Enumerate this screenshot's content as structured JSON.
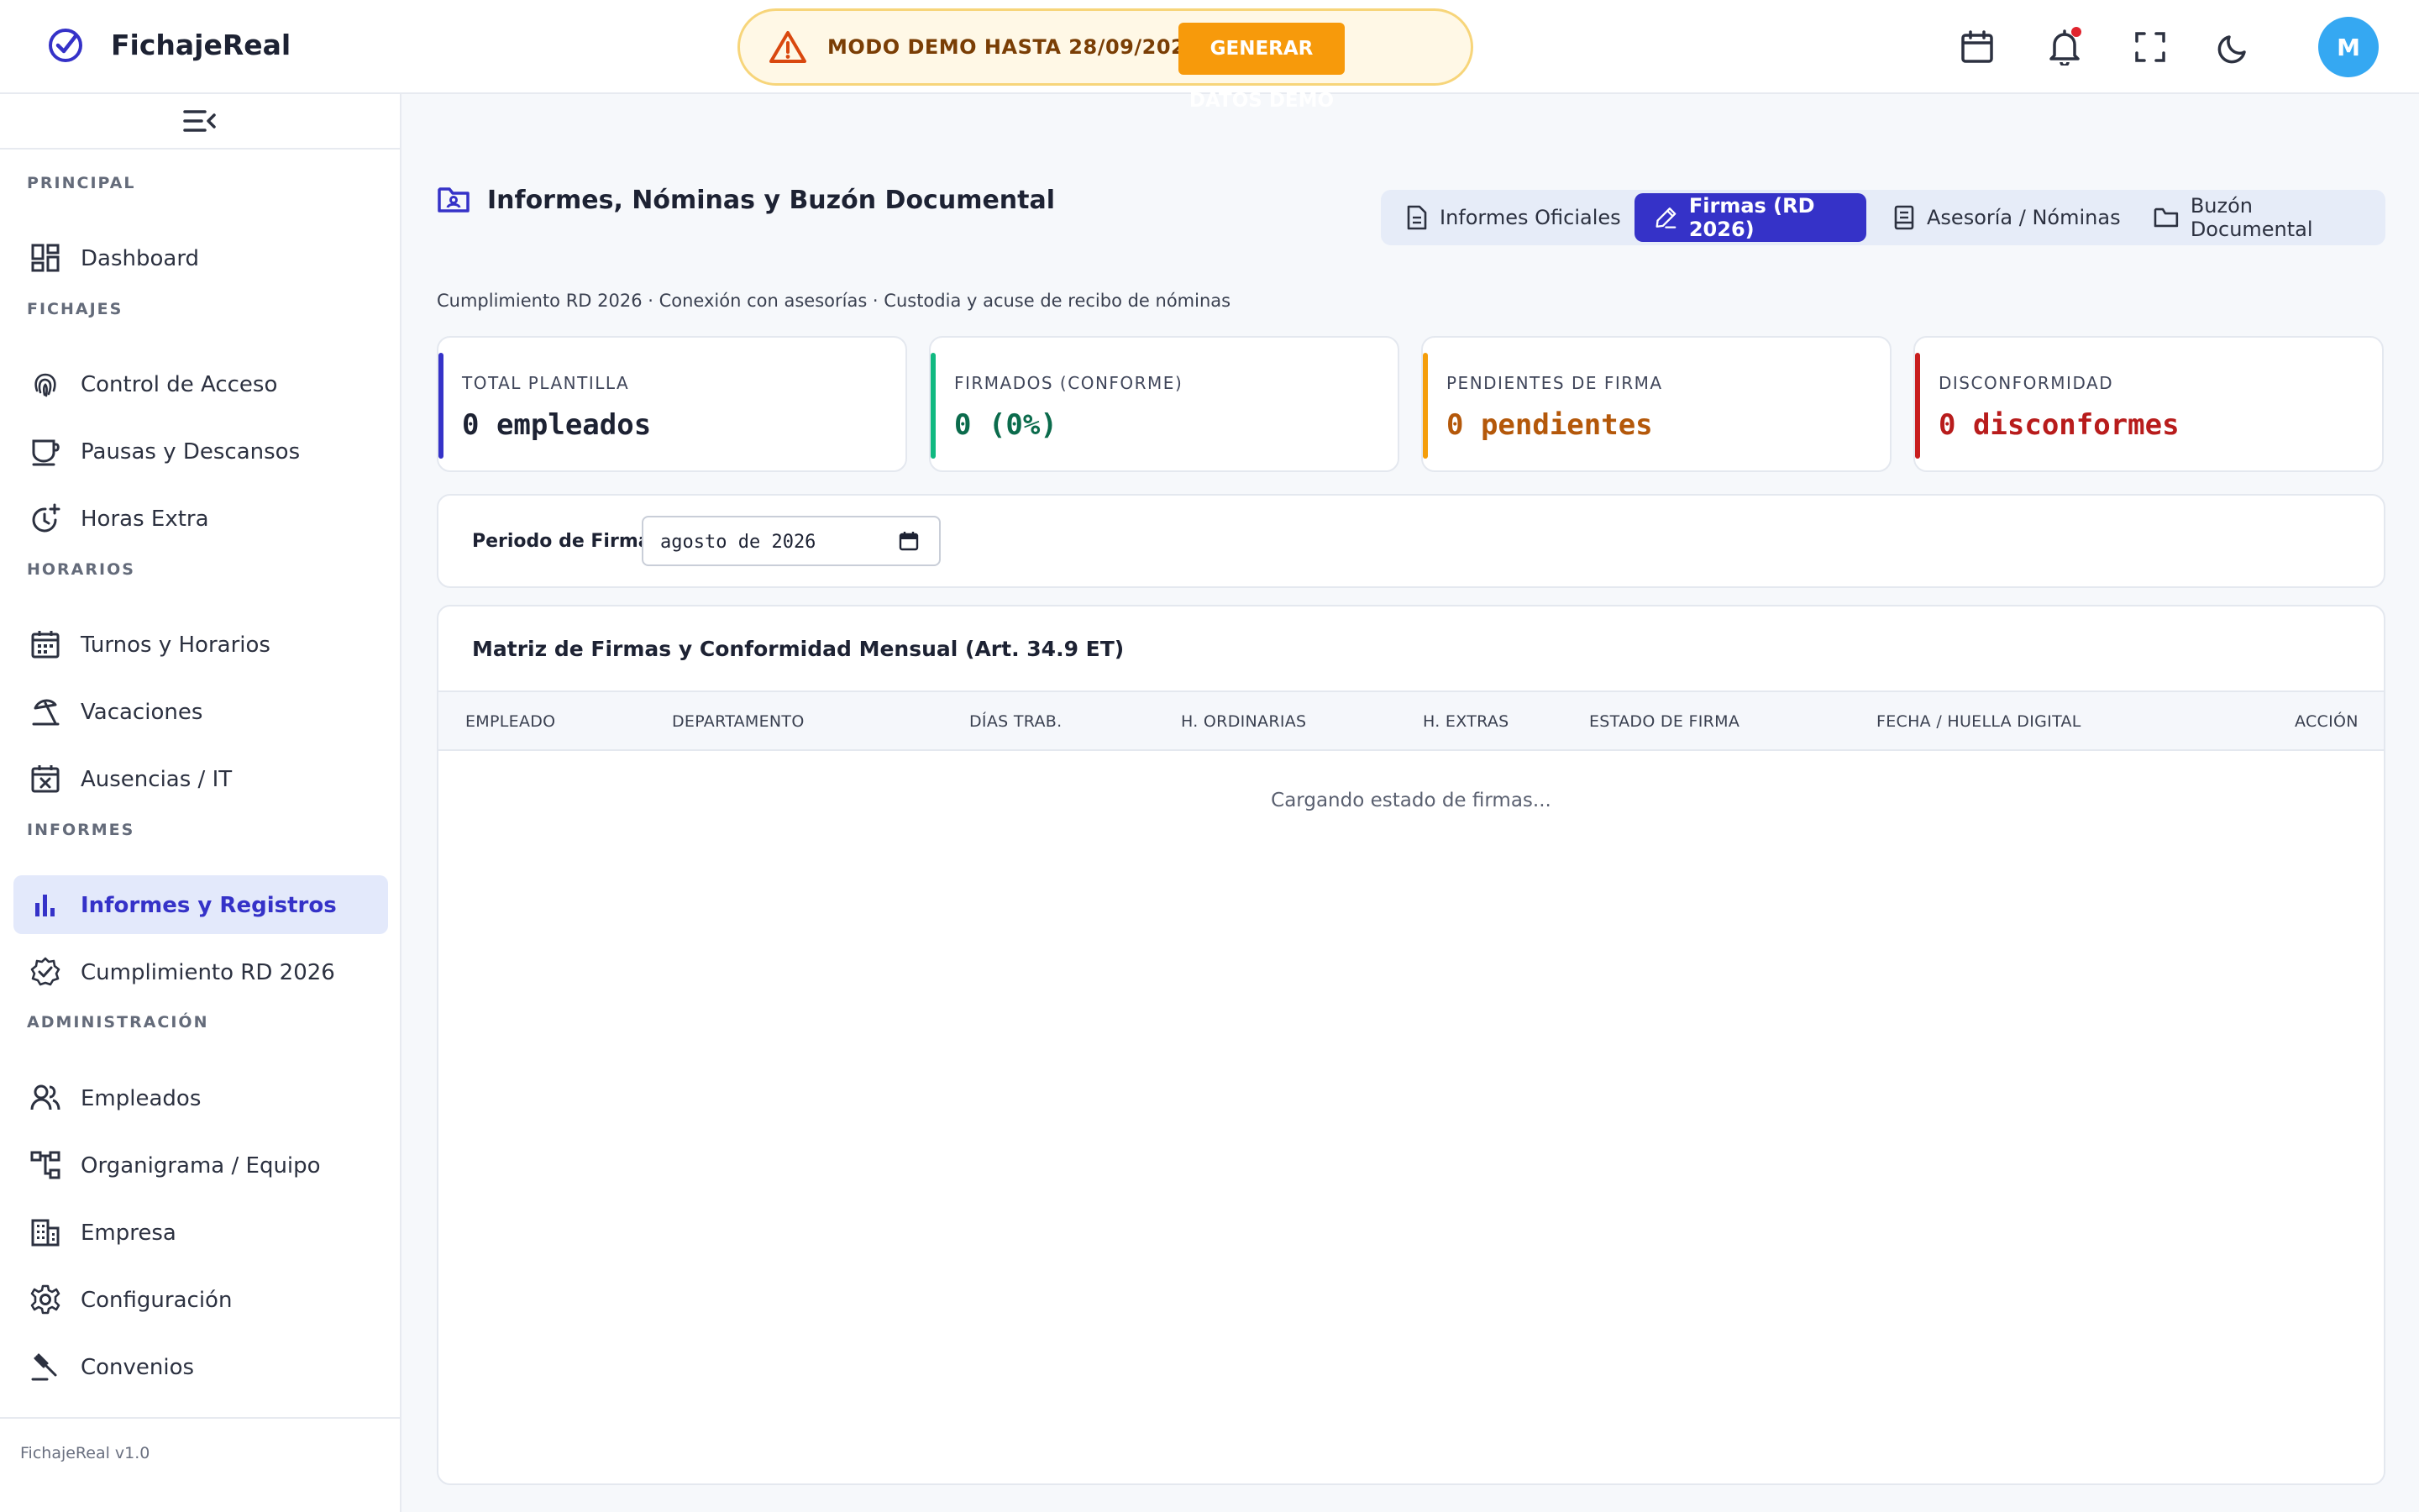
{
  "app": {
    "name": "FichajeReal",
    "version": "FichajeReal v1.0",
    "user_initial": "M"
  },
  "demo": {
    "text": "MODO DEMO HASTA 28/09/2026",
    "button": "GENERAR DATOS DEMO"
  },
  "sidebar": {
    "sections": {
      "principal": "PRINCIPAL",
      "fichajes": "FICHAJES",
      "horarios": "HORARIOS",
      "informes": "INFORMES",
      "administracion": "ADMINISTRACIÓN"
    },
    "items": {
      "dashboard": "Dashboard",
      "control_acceso": "Control de Acceso",
      "pausas": "Pausas y Descansos",
      "horas_extra": "Horas Extra",
      "turnos": "Turnos y Horarios",
      "vacaciones": "Vacaciones",
      "ausencias": "Ausencias / IT",
      "informes_registros": "Informes y Registros",
      "cumplimiento": "Cumplimiento RD 2026",
      "empleados": "Empleados",
      "organigrama": "Organigrama / Equipo",
      "empresa": "Empresa",
      "configuracion": "Configuración",
      "convenios": "Convenios"
    }
  },
  "page": {
    "title": "Informes, Nóminas y Buzón Documental",
    "subtitle": "Cumplimiento RD 2026 · Conexión con asesorías · Custodia y acuse de recibo de nóminas"
  },
  "tabs": {
    "informes": "Informes Oficiales",
    "firmas": "Firmas (RD 2026)",
    "asesoria": "Asesoría / Nóminas",
    "buzon": "Buzón Documental"
  },
  "stats": {
    "total": {
      "label": "TOTAL PLANTILLA",
      "value": "0 empleados",
      "color": "#3532c8"
    },
    "firmados": {
      "label": "FIRMADOS (CONFORME)",
      "value": "0 (0%)",
      "color": "#10b981"
    },
    "pendientes": {
      "label": "PENDIENTES DE FIRMA",
      "value": "0 pendientes",
      "color": "#f59e0b"
    },
    "disconformidad": {
      "label": "DISCONFORMIDAD",
      "value": "0 disconformes",
      "color": "#c81e1e"
    }
  },
  "period": {
    "label": "Periodo de Firma:",
    "value": "agosto de 2026"
  },
  "matrix": {
    "title": "Matriz de Firmas y Conformidad Mensual (Art. 34.9 ET)",
    "columns": {
      "empleado": "EMPLEADO",
      "departamento": "DEPARTAMENTO",
      "dias": "DÍAS TRAB.",
      "h_ord": "H. ORDINARIAS",
      "h_ext": "H. EXTRAS",
      "estado": "ESTADO DE FIRMA",
      "fecha": "FECHA / HUELLA DIGITAL",
      "accion": "ACCIÓN"
    },
    "loading": "Cargando estado de firmas..."
  }
}
